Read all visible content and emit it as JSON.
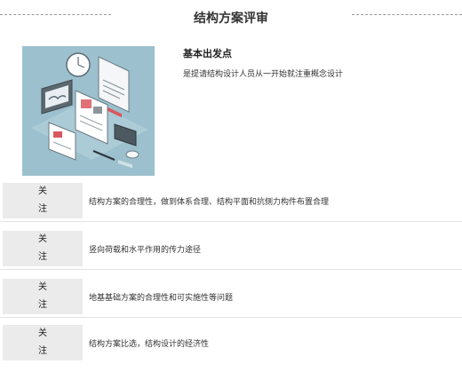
{
  "page": {
    "title": "结构方案评审"
  },
  "intro": {
    "heading": "基本出发点",
    "text": "是提请结构设计人员从一开始就注重概念设计"
  },
  "items": [
    {
      "tag": "关\n注",
      "text": "结构方案的合理性，做到体系合理、结构平面和抗侧力构件布置合理"
    },
    {
      "tag": "关\n注",
      "text": "竖向荷载和水平作用的传力途径"
    },
    {
      "tag": "关\n注",
      "text": "地基基础方案的合理性和可实施性等问题"
    },
    {
      "tag": "关\n注",
      "text": "结构方案比选，结构设计的经济性"
    }
  ],
  "colors": {
    "illustration_bg": "#9cc0cd",
    "tag_bg": "#ebebeb"
  }
}
